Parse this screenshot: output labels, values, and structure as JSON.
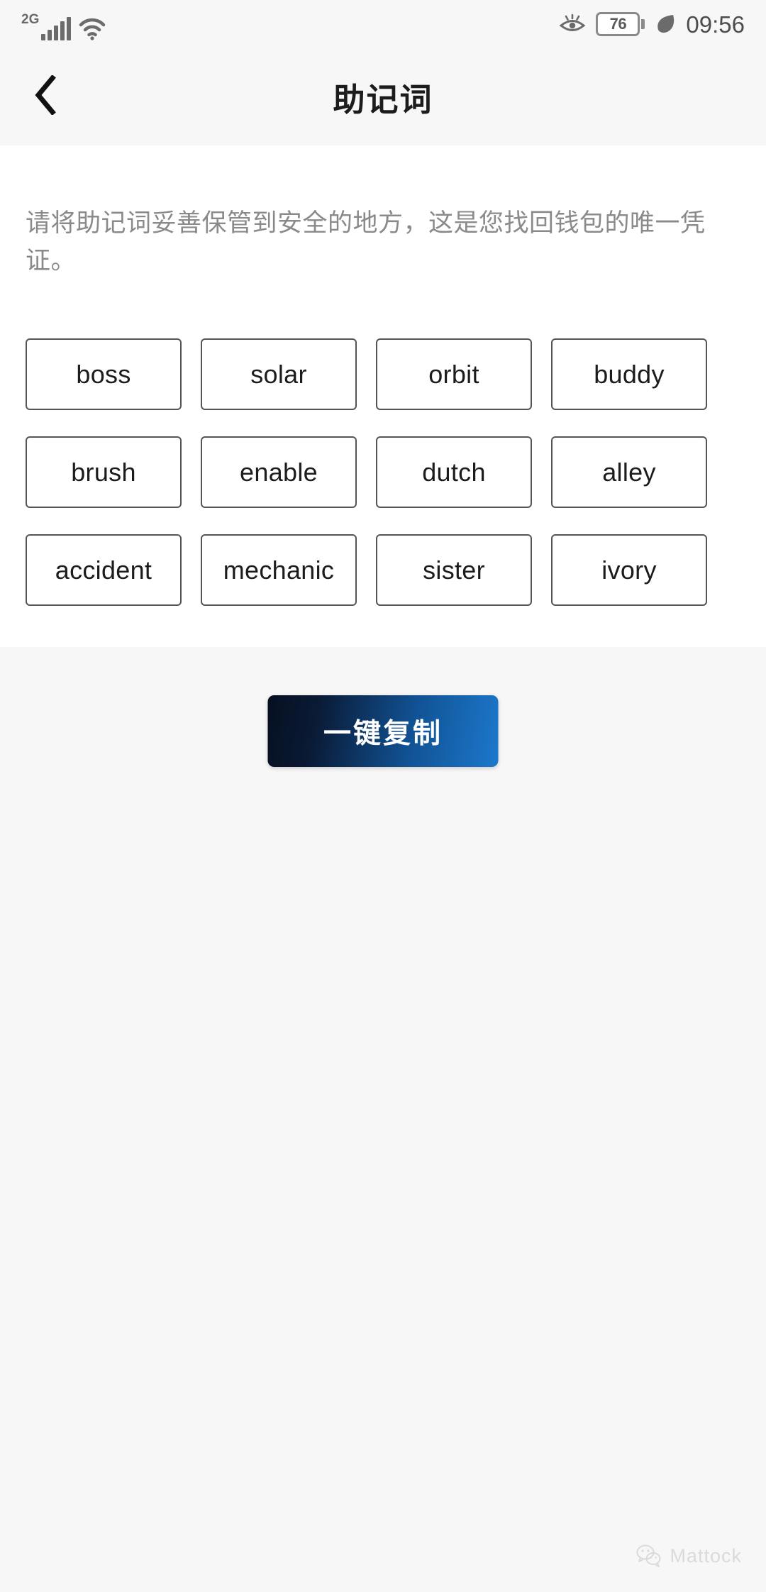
{
  "status_bar": {
    "network_label": "2G",
    "signal_icon": "signal-bars-icon",
    "wifi_icon": "wifi-icon",
    "eye_comfort_icon": "eye-comfort-icon",
    "battery_level": "76",
    "power_saving_icon": "leaf-icon",
    "time": "09:56"
  },
  "header": {
    "back_icon": "chevron-left-icon",
    "title": "助记词"
  },
  "content": {
    "description": "请将助记词妥善保管到安全的地方，这是您找回钱包的唯一凭证。",
    "mnemonic_words": [
      "boss",
      "solar",
      "orbit",
      "buddy",
      "brush",
      "enable",
      "dutch",
      "alley",
      "accident",
      "mechanic",
      "sister",
      "ivory"
    ]
  },
  "actions": {
    "copy_label": "一键复制"
  },
  "watermark": {
    "icon": "wechat-icon",
    "text": "Mattock"
  },
  "colors": {
    "page_background": "#f7f7f7",
    "card_background": "#ffffff",
    "title_text": "#1c1c1c",
    "description_text": "#8a8a8a",
    "word_border": "#555555",
    "word_text": "#1c1c1c",
    "button_gradient_start": "#060f20",
    "button_gradient_end": "#1c78cc",
    "button_text": "#ffffff"
  }
}
